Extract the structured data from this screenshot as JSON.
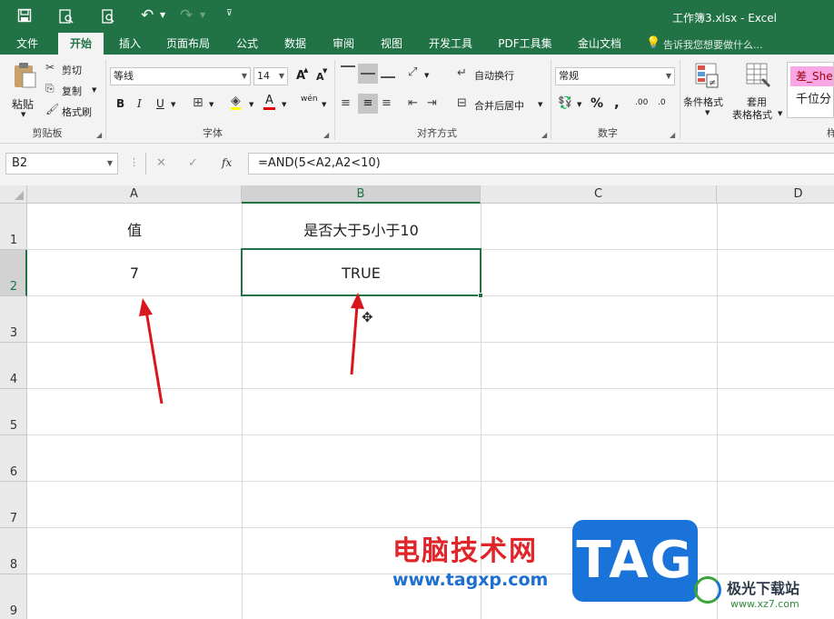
{
  "window": {
    "title": "工作簿3.xlsx - Excel"
  },
  "tabs": [
    {
      "label": "文件"
    },
    {
      "label": "开始"
    },
    {
      "label": "插入"
    },
    {
      "label": "页面布局"
    },
    {
      "label": "公式"
    },
    {
      "label": "数据"
    },
    {
      "label": "审阅"
    },
    {
      "label": "视图"
    },
    {
      "label": "开发工具"
    },
    {
      "label": "PDF工具集"
    },
    {
      "label": "金山文档"
    }
  ],
  "tell_me": "告诉我您想要做什么...",
  "ribbon": {
    "clipboard": {
      "label": "剪贴板",
      "paste": "粘贴",
      "cut": "剪切",
      "copy": "复制",
      "format_painter": "格式刷"
    },
    "font": {
      "label": "字体",
      "name": "等线",
      "size": "14",
      "bold": "B",
      "italic": "I",
      "underline": "U",
      "grow": "A",
      "shrink": "A",
      "font_color": "A",
      "phonetic": "wén"
    },
    "alignment": {
      "label": "对齐方式",
      "wrap": "自动换行",
      "merge": "合并后居中"
    },
    "number": {
      "label": "数字",
      "format": "常规",
      "percent": "%",
      "comma": ",",
      "inc": ".00",
      "dec": ".0"
    },
    "styles": {
      "conditional": "条件格式",
      "table_format_1": "套用",
      "table_format_2": "表格格式",
      "bad": "差_She",
      "thousands": "千位分",
      "partial": "样"
    }
  },
  "formula_bar": {
    "name_box": "B2",
    "cancel": "✕",
    "enter": "✓",
    "fx": "fx",
    "formula": "=AND(5<A2,A2<10)"
  },
  "columns": [
    "A",
    "B",
    "C",
    "D"
  ],
  "rows": [
    "1",
    "2",
    "3",
    "4",
    "5",
    "6",
    "7",
    "8",
    "9"
  ],
  "cells": {
    "A1": "值",
    "B1": "是否大于5小于10",
    "A2": "7",
    "B2": "TRUE"
  },
  "watermark": {
    "site_text": "电脑技术网",
    "site_url": "www.tagxp.com",
    "tag": "TAG",
    "xz_name": "极光下载站",
    "xz_url": "www.xz7.com"
  }
}
